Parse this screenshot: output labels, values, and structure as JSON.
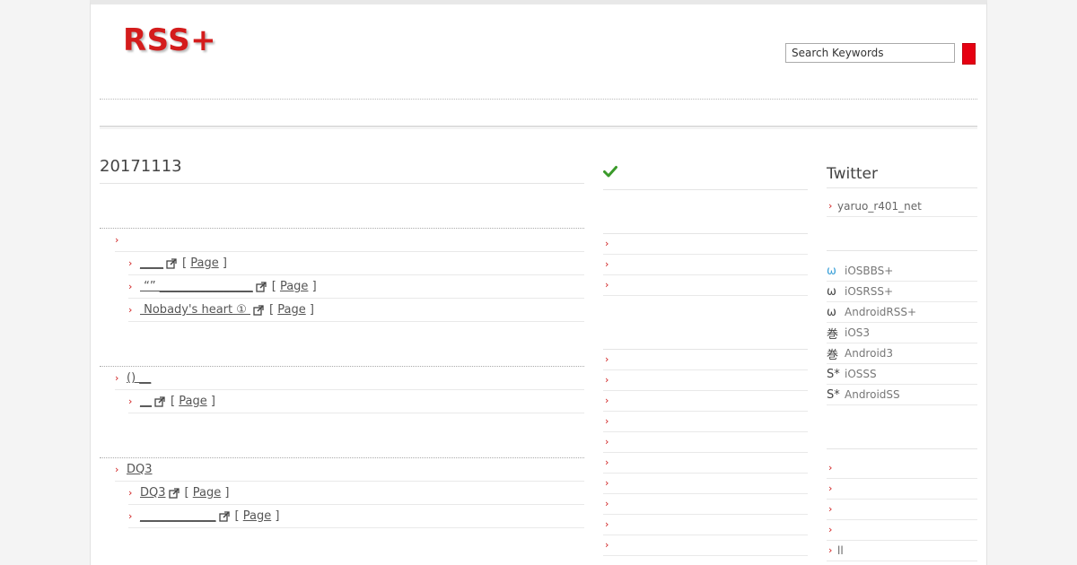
{
  "header": {
    "logo": "RSS+",
    "search_placeholder": "Search Keywords"
  },
  "main": {
    "date_title": "20171113",
    "sections": [
      {
        "heading": "",
        "items": [
          {
            "title": "____",
            "page": "Page"
          },
          {
            "title": " “” ________________",
            "page": "Page"
          },
          {
            "title": " Nobady's heart ① ",
            "page": "Page"
          }
        ]
      },
      {
        "heading": "() __",
        "items": [
          {
            "title": "__",
            "page": "Page"
          }
        ]
      },
      {
        "heading": "DQ3",
        "items": [
          {
            "title": "DQ3",
            "page": "Page"
          },
          {
            "title": "_____________",
            "page": "Page"
          }
        ]
      }
    ]
  },
  "mid": {
    "check_icon": "check-icon",
    "top_rows": 3,
    "bottom_rows": 10
  },
  "side": {
    "twitter_title": "Twitter",
    "twitter_account": "yaruo_r401_net",
    "apps": [
      {
        "icon": "ω",
        "label": "iOSBBS+",
        "color": "#3aa0d8"
      },
      {
        "icon": "ω",
        "label": "iOSRSS+",
        "color": "#444444"
      },
      {
        "icon": "ω",
        "label": "AndroidRSS+",
        "color": "#444444"
      },
      {
        "icon": "巻",
        "label": "iOS3",
        "color": "#444444"
      },
      {
        "icon": "巻",
        "label": "Android3",
        "color": "#444444"
      },
      {
        "icon": "S*",
        "label": "iOSSS",
        "color": "#444444"
      },
      {
        "icon": "S*",
        "label": "AndroidSS",
        "color": "#444444"
      }
    ],
    "bottom_rows": [
      "",
      "",
      "",
      "",
      "ll",
      ""
    ]
  },
  "colors": {
    "accent": "#d41c1c",
    "search_button": "#e60012",
    "check": "#3a9a2a"
  }
}
